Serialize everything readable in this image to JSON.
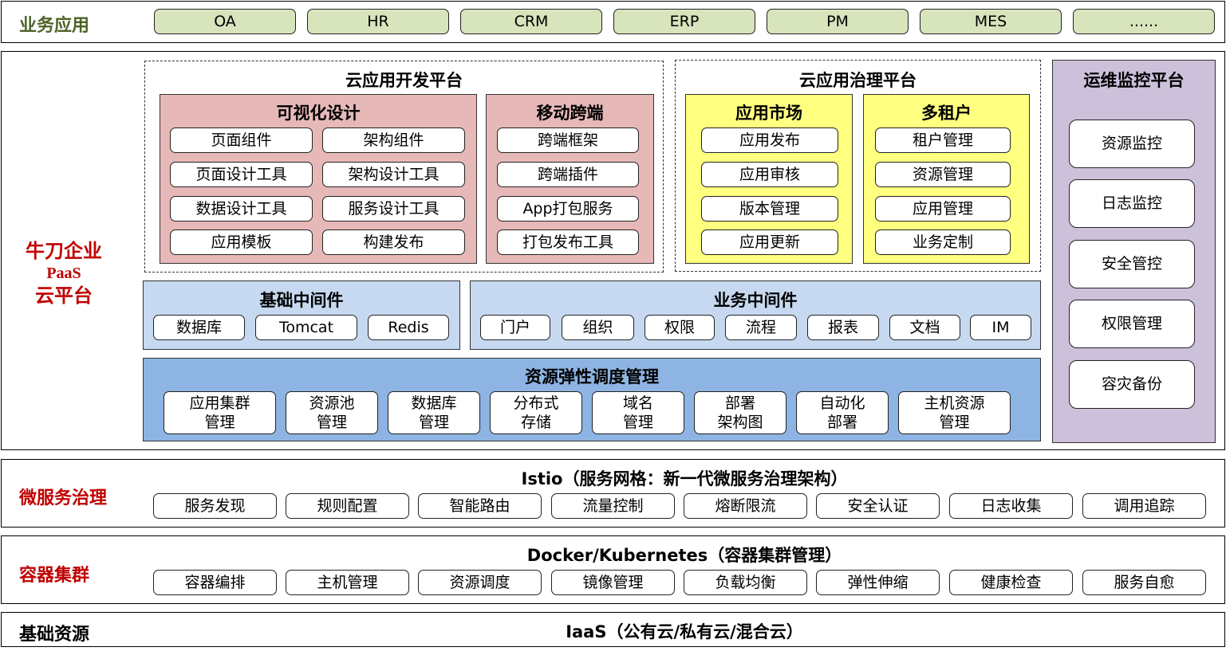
{
  "business_apps": {
    "label": "业务应用",
    "items": [
      "OA",
      "HR",
      "CRM",
      "ERP",
      "PM",
      "MES",
      "......"
    ]
  },
  "paas": {
    "label_line1": "牛刀企业",
    "label_line2": "PaaS",
    "label_line3": "云平台",
    "dev_platform": {
      "title": "云应用开发平台",
      "visual_design": {
        "title": "可视化设计",
        "items": [
          "页面组件",
          "架构组件",
          "页面设计工具",
          "架构设计工具",
          "数据设计工具",
          "服务设计工具",
          "应用模板",
          "构建发布"
        ]
      },
      "mobile": {
        "title": "移动跨端",
        "items": [
          "跨端框架",
          "跨端插件",
          "App打包服务",
          "打包发布工具"
        ]
      }
    },
    "gov_platform": {
      "title": "云应用治理平台",
      "app_market": {
        "title": "应用市场",
        "items": [
          "应用发布",
          "应用审核",
          "版本管理",
          "应用更新"
        ]
      },
      "multi_tenant": {
        "title": "多租户",
        "items": [
          "租户管理",
          "资源管理",
          "应用管理",
          "业务定制"
        ]
      }
    },
    "ops_platform": {
      "title": "运维监控平台",
      "items": [
        "资源监控",
        "日志监控",
        "安全管控",
        "权限管理",
        "容灾备份"
      ]
    },
    "base_middleware": {
      "title": "基础中间件",
      "items": [
        "数据库",
        "Tomcat",
        "Redis"
      ]
    },
    "biz_middleware": {
      "title": "业务中间件",
      "items": [
        "门户",
        "组织",
        "权限",
        "流程",
        "报表",
        "文档",
        "IM"
      ]
    },
    "resource_sched": {
      "title": "资源弹性调度管理",
      "items": [
        {
          "l1": "应用集群",
          "l2": "管理"
        },
        {
          "l1": "资源池",
          "l2": "管理"
        },
        {
          "l1": "数据库",
          "l2": "管理"
        },
        {
          "l1": "分布式",
          "l2": "存储"
        },
        {
          "l1": "域名",
          "l2": "管理"
        },
        {
          "l1": "部署",
          "l2": "架构图"
        },
        {
          "l1": "自动化",
          "l2": "部署"
        },
        {
          "l1": "主机资源",
          "l2": "管理"
        }
      ]
    }
  },
  "microservice": {
    "label": "微服务治理",
    "title": "Istio（服务网格：新一代微服务治理架构）",
    "items": [
      "服务发现",
      "规则配置",
      "智能路由",
      "流量控制",
      "熔断限流",
      "安全认证",
      "日志收集",
      "调用追踪"
    ]
  },
  "container": {
    "label": "容器集群",
    "title": "Docker/Kubernetes（容器集群管理）",
    "items": [
      "容器编排",
      "主机管理",
      "资源调度",
      "镜像管理",
      "负载均衡",
      "弹性伸缩",
      "健康检查",
      "服务自愈"
    ]
  },
  "infra": {
    "label": "基础资源",
    "title": "IaaS（公有云/私有云/混合云）"
  },
  "colors": {
    "green_box": "#d8e4bc",
    "pink_box": "#e6b9b8",
    "yellow_box": "#ffff80",
    "light_blue_box": "#c6d9f1",
    "mid_blue_box": "#8db4e2",
    "purple_box": "#ccc0da",
    "red_label": "#c00000",
    "olive_label": "#4f6228"
  }
}
